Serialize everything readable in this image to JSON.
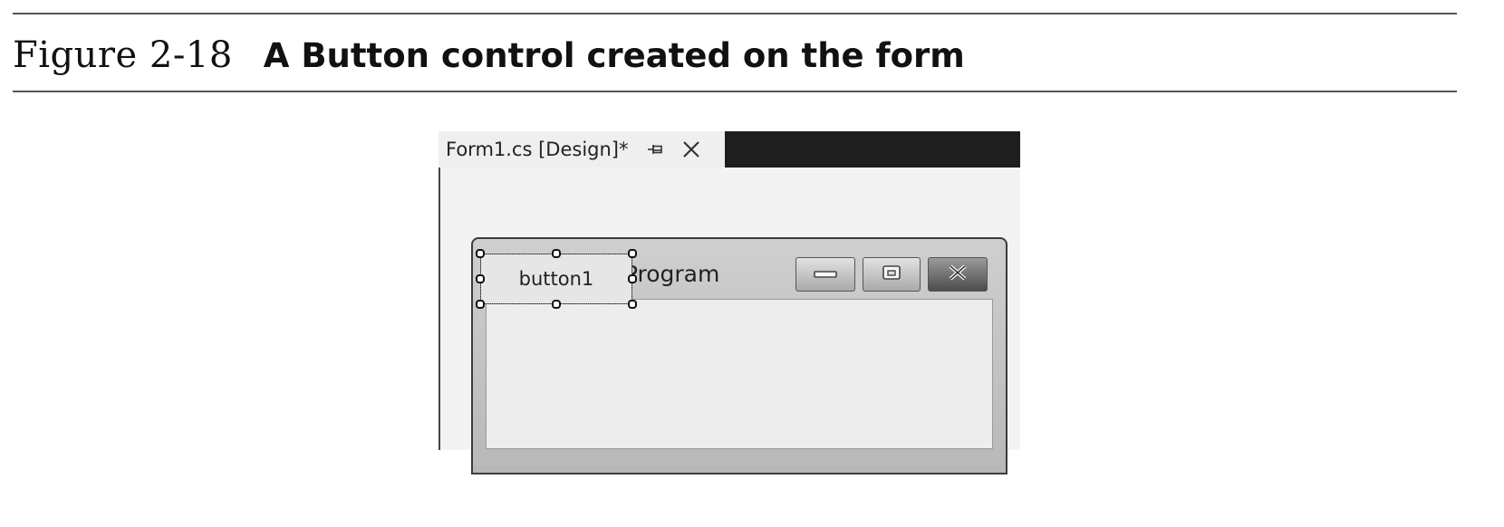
{
  "figure": {
    "number": "Figure 2-18",
    "title": "A Button control created on the form"
  },
  "ide": {
    "tab_label": "Form1.cs [Design]*",
    "icons": {
      "pin": "pin-icon",
      "close": "close-icon"
    }
  },
  "form": {
    "title": "My First Program",
    "icon": "form-app-icon",
    "caption_buttons": [
      "minimize-icon",
      "maximize-icon",
      "close-icon"
    ]
  },
  "controls": {
    "button1_text": "button1",
    "selected": true
  },
  "colors": {
    "rule": "#555555",
    "tab_strip": "#1e1e1e",
    "tab_bg": "#efefef",
    "client_area": "#ededed",
    "close_button": "#4d4d4d"
  }
}
